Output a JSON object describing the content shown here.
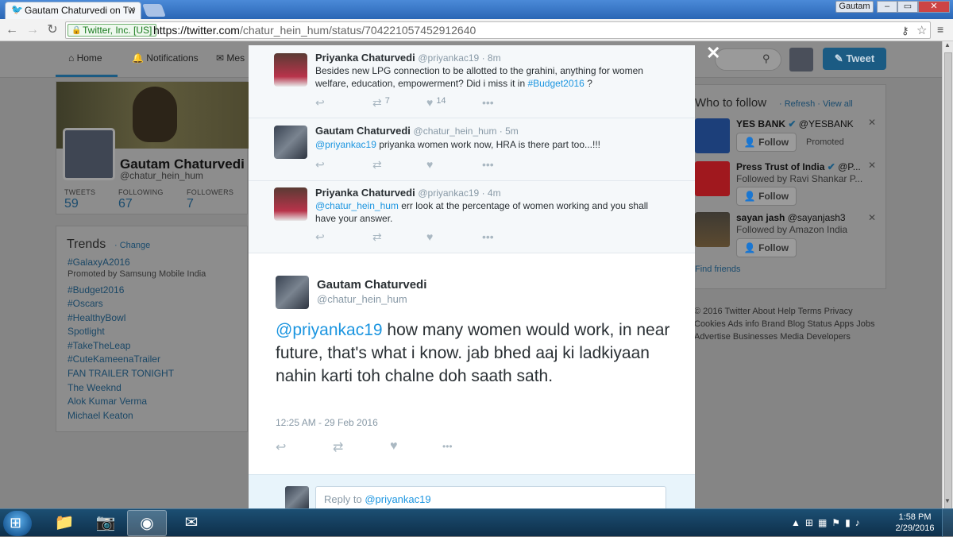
{
  "browser": {
    "tab_title": "Gautam Chaturvedi on Tw",
    "user_label": "Gautam",
    "ev_label": "Twitter, Inc. [US]",
    "url_scheme": "https://",
    "url_host": "twitter.com",
    "url_path": "/chatur_hein_hum/status/704221057452912640"
  },
  "twitter_nav": {
    "home": "Home",
    "notifications": "Notifications",
    "messages": "Mes",
    "tweet_button": "Tweet"
  },
  "profile": {
    "name": "Gautam Chaturvedi",
    "handle": "@chatur_hein_hum",
    "stats": [
      {
        "label": "TWEETS",
        "value": "59"
      },
      {
        "label": "FOLLOWING",
        "value": "67"
      },
      {
        "label": "FOLLOWERS",
        "value": "7"
      }
    ]
  },
  "trends": {
    "title": "Trends",
    "change": "· Change",
    "items": [
      "#GalaxyA2016",
      "#Budget2016",
      "#Oscars",
      "#HealthyBowl",
      "Spotlight",
      "#TakeTheLeap",
      "#CuteKameenaTrailer",
      "FAN TRAILER TONIGHT",
      "The Weeknd",
      "Alok Kumar Verma",
      "Michael Keaton"
    ],
    "promoted": "Promoted by Samsung Mobile India"
  },
  "who_to_follow": {
    "title": "Who to follow",
    "links": "· Refresh · View all",
    "follow_label": "Follow",
    "promoted_label": "Promoted",
    "accounts": [
      {
        "name": "YES BANK",
        "handle": "@YESBANK",
        "sub": ""
      },
      {
        "name": "Press Trust of India",
        "handle": "@P...",
        "sub": "Followed by Ravi Shankar P..."
      },
      {
        "name": "sayan jash",
        "handle": "@sayanjash3",
        "sub": "Followed by Amazon India"
      }
    ],
    "find_friends": "Find friends"
  },
  "footer": "© 2016 Twitter  About  Help  Terms  Privacy  Cookies  Ads info  Brand  Blog  Status  Apps  Jobs  Advertise  Businesses  Media  Developers",
  "conversation": [
    {
      "name": "Priyanka Chaturvedi",
      "handle": "@priyankac19 · 8m",
      "text_plain": "Besides new LPG connection to be allotted to the grahini, anything for women welfare, education, empowerment? Did i miss it in ",
      "hashtag": "#Budget2016",
      "text_end": " ?",
      "retweets": "7",
      "likes": "14"
    },
    {
      "name": "Gautam Chaturvedi",
      "handle": "@chatur_hein_hum · 5m",
      "mention": "@priyankac19",
      "text_plain": " priyanka women work now, HRA is there part too...!!!"
    },
    {
      "name": "Priyanka Chaturvedi",
      "handle": "@priyankac19 · 4m",
      "mention": "@chatur_hein_hum",
      "text_plain": " err look at the percentage of women working and you shall have your answer."
    }
  ],
  "main_tweet": {
    "name": "Gautam Chaturvedi",
    "handle": "@chatur_hein_hum",
    "mention": "@priyankac19",
    "text": " how many women would work, in near future, that's what i know. jab bhed aaj ki ladkiyaan nahin karti toh chalne doh saath sath.",
    "timestamp": "12:25 AM - 29 Feb 2016"
  },
  "reply": {
    "prefix": "Reply to ",
    "mention": "@priyankac19"
  },
  "taskbar": {
    "time": "1:58 PM",
    "date": "2/29/2016"
  }
}
